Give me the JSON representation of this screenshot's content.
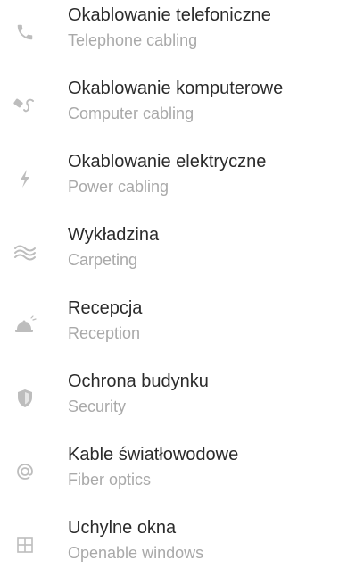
{
  "amenities": {
    "items": [
      {
        "icon": "phone-icon",
        "title": "Okablowanie telefoniczne",
        "subtitle": "Telephone cabling"
      },
      {
        "icon": "network-cable-icon",
        "title": "Okablowanie komputerowe",
        "subtitle": "Computer cabling"
      },
      {
        "icon": "lightning-icon",
        "title": "Okablowanie elektryczne",
        "subtitle": "Power cabling"
      },
      {
        "icon": "waves-icon",
        "title": "Wykładzina",
        "subtitle": "Carpeting"
      },
      {
        "icon": "reception-bell-icon",
        "title": "Recepcja",
        "subtitle": "Reception"
      },
      {
        "icon": "shield-icon",
        "title": "Ochrona budynku",
        "subtitle": "Security"
      },
      {
        "icon": "at-sign-icon",
        "title": "Kable światłowodowe",
        "subtitle": "Fiber optics"
      },
      {
        "icon": "window-icon",
        "title": "Uchylne okna",
        "subtitle": "Openable windows"
      }
    ]
  }
}
